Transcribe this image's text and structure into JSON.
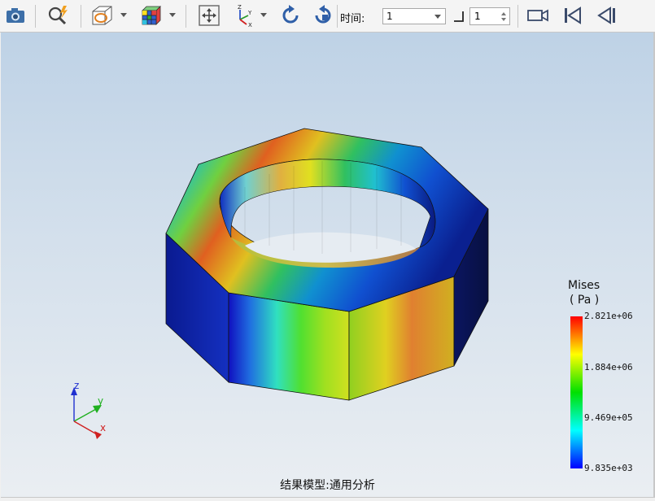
{
  "toolbar": {
    "time_label": "时间:",
    "time_value": "1",
    "step_value": "1"
  },
  "legend": {
    "title": "Mises",
    "unit": "( Pa )",
    "ticks": [
      "2.821e+06",
      "1.884e+06",
      "9.469e+05",
      "9.835e+03"
    ],
    "colors": [
      "#ff0000",
      "#ffff00",
      "#00e000",
      "#00ffff",
      "#0000ff"
    ]
  },
  "axes": {
    "x": "x",
    "y": "y",
    "z": "z"
  },
  "status": "结果模型:通用分析"
}
